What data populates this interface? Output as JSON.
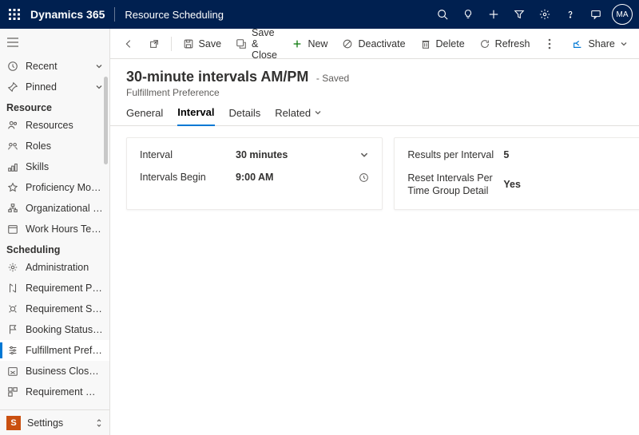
{
  "topbar": {
    "brand": "Dynamics 365",
    "app": "Resource Scheduling",
    "avatar_initials": "MA"
  },
  "sidebar": {
    "recent": "Recent",
    "pinned": "Pinned",
    "group_resource": "Resource",
    "group_scheduling": "Scheduling",
    "resource_items": [
      "Resources",
      "Roles",
      "Skills",
      "Proficiency Models",
      "Organizational Un...",
      "Work Hours Temp..."
    ],
    "scheduling_items": [
      "Administration",
      "Requirement Prior...",
      "Requirement Stat...",
      "Booking Statuses",
      "Fulfillment Prefer...",
      "Business Closures",
      "Requirement Gro..."
    ],
    "footer_badge": "S",
    "footer_label": "Settings"
  },
  "commandbar": {
    "save": "Save",
    "save_close": "Save & Close",
    "new": "New",
    "deactivate": "Deactivate",
    "delete": "Delete",
    "refresh": "Refresh",
    "share": "Share"
  },
  "record": {
    "title": "30-minute intervals AM/PM",
    "status": "- Saved",
    "subtitle": "Fulfillment Preference"
  },
  "tabs": {
    "general": "General",
    "interval": "Interval",
    "details": "Details",
    "related": "Related"
  },
  "form": {
    "interval_label": "Interval",
    "interval_value": "30 minutes",
    "intervals_begin_label": "Intervals Begin",
    "intervals_begin_value": "9:00 AM",
    "results_per_interval_label": "Results per Interval",
    "results_per_interval_value": "5",
    "reset_label": "Reset Intervals Per Time Group Detail",
    "reset_value": "Yes"
  }
}
